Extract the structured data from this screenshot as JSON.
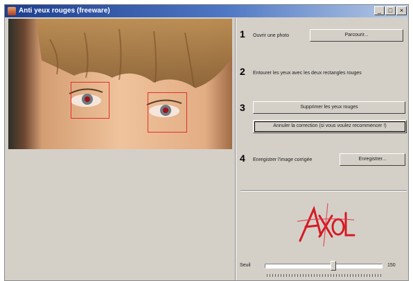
{
  "window": {
    "title": "Anti yeux rouges (freeware)",
    "buttons": [
      "_",
      "□",
      "×"
    ]
  },
  "steps": [
    {
      "number": "1",
      "label": "Ouvrir une photo",
      "button": "Parcourir..."
    },
    {
      "number": "2",
      "label": "Entourer les yeux avec les deux rectangles rouges"
    },
    {
      "number": "3",
      "button": "Supprimer les yeux rouges",
      "button2": "Annuler la correction (si vous voulez recommencer !)"
    },
    {
      "number": "4",
      "label": "Enregistrer l'image corrigée",
      "button": "Enregistrer..."
    }
  ],
  "logo": {
    "text": "AXOL"
  },
  "threshold": {
    "label": "Seuil",
    "value": "150",
    "max": 255
  },
  "colors": {
    "title_bar": "#1c3d8e",
    "face_box": "#d4d0c8",
    "selection": "#e0302a"
  }
}
